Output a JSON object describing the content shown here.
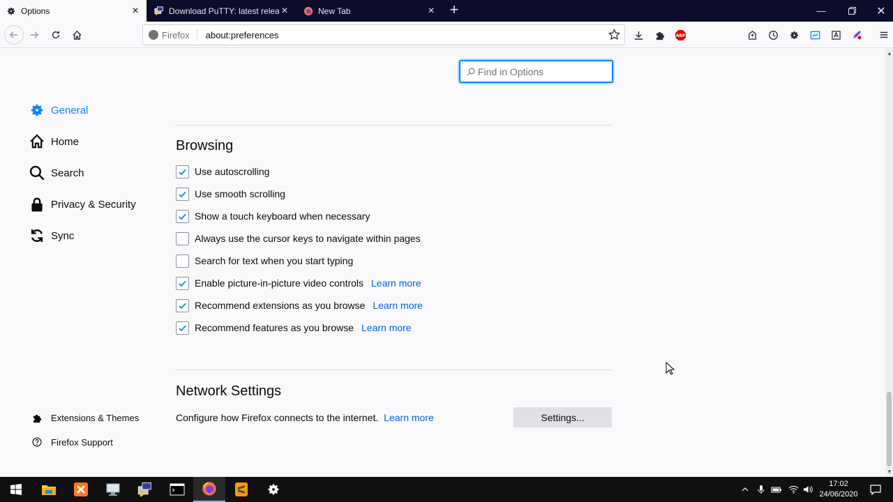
{
  "browser": {
    "tabs": [
      {
        "title": "Options",
        "icon": "gear-icon",
        "active": true
      },
      {
        "title": "Download PuTTY: latest release",
        "icon": "putty-icon",
        "active": false
      },
      {
        "title": "New Tab",
        "icon": "firefox-icon",
        "active": false
      }
    ],
    "url_identity": "Firefox",
    "url": "about:preferences"
  },
  "search": {
    "placeholder": "Find in Options",
    "value": ""
  },
  "sidebar": {
    "categories": [
      {
        "label": "General",
        "icon": "gear-icon",
        "selected": true
      },
      {
        "label": "Home",
        "icon": "home-icon",
        "selected": false
      },
      {
        "label": "Search",
        "icon": "search-icon",
        "selected": false
      },
      {
        "label": "Privacy & Security",
        "icon": "lock-icon",
        "selected": false
      },
      {
        "label": "Sync",
        "icon": "sync-icon",
        "selected": false
      }
    ],
    "footer": [
      {
        "label": "Extensions & Themes",
        "icon": "puzzle-icon"
      },
      {
        "label": "Firefox Support",
        "icon": "help-icon"
      }
    ]
  },
  "browsing": {
    "title": "Browsing",
    "options": [
      {
        "label": "Use autoscrolling",
        "checked": true,
        "learn_more": ""
      },
      {
        "label": "Use smooth scrolling",
        "checked": true,
        "learn_more": ""
      },
      {
        "label": "Show a touch keyboard when necessary",
        "checked": true,
        "learn_more": ""
      },
      {
        "label": "Always use the cursor keys to navigate within pages",
        "checked": false,
        "learn_more": ""
      },
      {
        "label": "Search for text when you start typing",
        "checked": false,
        "learn_more": ""
      },
      {
        "label": "Enable picture-in-picture video controls",
        "checked": true,
        "learn_more": "Learn more"
      },
      {
        "label": "Recommend extensions as you browse",
        "checked": true,
        "learn_more": "Learn more"
      },
      {
        "label": "Recommend features as you browse",
        "checked": true,
        "learn_more": "Learn more"
      }
    ]
  },
  "network": {
    "title": "Network Settings",
    "description": "Configure how Firefox connects to the internet.",
    "learn_more": "Learn more",
    "button": "Settings..."
  },
  "taskbar": {
    "time": "17:02",
    "date": "24/06/2020"
  },
  "colors": {
    "accent": "#0a84ff",
    "link": "#0060df",
    "tabbar": "#0c0c2b"
  }
}
